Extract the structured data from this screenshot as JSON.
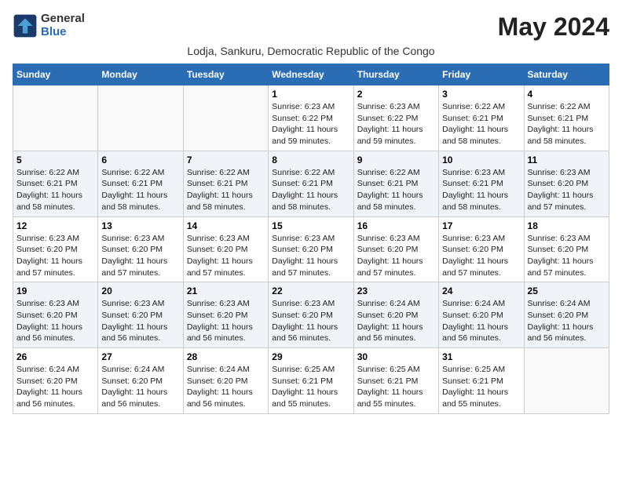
{
  "logo": {
    "general": "General",
    "blue": "Blue"
  },
  "title": "May 2024",
  "subtitle": "Lodja, Sankuru, Democratic Republic of the Congo",
  "headers": [
    "Sunday",
    "Monday",
    "Tuesday",
    "Wednesday",
    "Thursday",
    "Friday",
    "Saturday"
  ],
  "weeks": [
    [
      {
        "day": "",
        "info": ""
      },
      {
        "day": "",
        "info": ""
      },
      {
        "day": "",
        "info": ""
      },
      {
        "day": "1",
        "info": "Sunrise: 6:23 AM\nSunset: 6:22 PM\nDaylight: 11 hours\nand 59 minutes."
      },
      {
        "day": "2",
        "info": "Sunrise: 6:23 AM\nSunset: 6:22 PM\nDaylight: 11 hours\nand 59 minutes."
      },
      {
        "day": "3",
        "info": "Sunrise: 6:22 AM\nSunset: 6:21 PM\nDaylight: 11 hours\nand 58 minutes."
      },
      {
        "day": "4",
        "info": "Sunrise: 6:22 AM\nSunset: 6:21 PM\nDaylight: 11 hours\nand 58 minutes."
      }
    ],
    [
      {
        "day": "5",
        "info": "Sunrise: 6:22 AM\nSunset: 6:21 PM\nDaylight: 11 hours\nand 58 minutes."
      },
      {
        "day": "6",
        "info": "Sunrise: 6:22 AM\nSunset: 6:21 PM\nDaylight: 11 hours\nand 58 minutes."
      },
      {
        "day": "7",
        "info": "Sunrise: 6:22 AM\nSunset: 6:21 PM\nDaylight: 11 hours\nand 58 minutes."
      },
      {
        "day": "8",
        "info": "Sunrise: 6:22 AM\nSunset: 6:21 PM\nDaylight: 11 hours\nand 58 minutes."
      },
      {
        "day": "9",
        "info": "Sunrise: 6:22 AM\nSunset: 6:21 PM\nDaylight: 11 hours\nand 58 minutes."
      },
      {
        "day": "10",
        "info": "Sunrise: 6:23 AM\nSunset: 6:21 PM\nDaylight: 11 hours\nand 58 minutes."
      },
      {
        "day": "11",
        "info": "Sunrise: 6:23 AM\nSunset: 6:20 PM\nDaylight: 11 hours\nand 57 minutes."
      }
    ],
    [
      {
        "day": "12",
        "info": "Sunrise: 6:23 AM\nSunset: 6:20 PM\nDaylight: 11 hours\nand 57 minutes."
      },
      {
        "day": "13",
        "info": "Sunrise: 6:23 AM\nSunset: 6:20 PM\nDaylight: 11 hours\nand 57 minutes."
      },
      {
        "day": "14",
        "info": "Sunrise: 6:23 AM\nSunset: 6:20 PM\nDaylight: 11 hours\nand 57 minutes."
      },
      {
        "day": "15",
        "info": "Sunrise: 6:23 AM\nSunset: 6:20 PM\nDaylight: 11 hours\nand 57 minutes."
      },
      {
        "day": "16",
        "info": "Sunrise: 6:23 AM\nSunset: 6:20 PM\nDaylight: 11 hours\nand 57 minutes."
      },
      {
        "day": "17",
        "info": "Sunrise: 6:23 AM\nSunset: 6:20 PM\nDaylight: 11 hours\nand 57 minutes."
      },
      {
        "day": "18",
        "info": "Sunrise: 6:23 AM\nSunset: 6:20 PM\nDaylight: 11 hours\nand 57 minutes."
      }
    ],
    [
      {
        "day": "19",
        "info": "Sunrise: 6:23 AM\nSunset: 6:20 PM\nDaylight: 11 hours\nand 56 minutes."
      },
      {
        "day": "20",
        "info": "Sunrise: 6:23 AM\nSunset: 6:20 PM\nDaylight: 11 hours\nand 56 minutes."
      },
      {
        "day": "21",
        "info": "Sunrise: 6:23 AM\nSunset: 6:20 PM\nDaylight: 11 hours\nand 56 minutes."
      },
      {
        "day": "22",
        "info": "Sunrise: 6:23 AM\nSunset: 6:20 PM\nDaylight: 11 hours\nand 56 minutes."
      },
      {
        "day": "23",
        "info": "Sunrise: 6:24 AM\nSunset: 6:20 PM\nDaylight: 11 hours\nand 56 minutes."
      },
      {
        "day": "24",
        "info": "Sunrise: 6:24 AM\nSunset: 6:20 PM\nDaylight: 11 hours\nand 56 minutes."
      },
      {
        "day": "25",
        "info": "Sunrise: 6:24 AM\nSunset: 6:20 PM\nDaylight: 11 hours\nand 56 minutes."
      }
    ],
    [
      {
        "day": "26",
        "info": "Sunrise: 6:24 AM\nSunset: 6:20 PM\nDaylight: 11 hours\nand 56 minutes."
      },
      {
        "day": "27",
        "info": "Sunrise: 6:24 AM\nSunset: 6:20 PM\nDaylight: 11 hours\nand 56 minutes."
      },
      {
        "day": "28",
        "info": "Sunrise: 6:24 AM\nSunset: 6:20 PM\nDaylight: 11 hours\nand 56 minutes."
      },
      {
        "day": "29",
        "info": "Sunrise: 6:25 AM\nSunset: 6:21 PM\nDaylight: 11 hours\nand 55 minutes."
      },
      {
        "day": "30",
        "info": "Sunrise: 6:25 AM\nSunset: 6:21 PM\nDaylight: 11 hours\nand 55 minutes."
      },
      {
        "day": "31",
        "info": "Sunrise: 6:25 AM\nSunset: 6:21 PM\nDaylight: 11 hours\nand 55 minutes."
      },
      {
        "day": "",
        "info": ""
      }
    ]
  ]
}
